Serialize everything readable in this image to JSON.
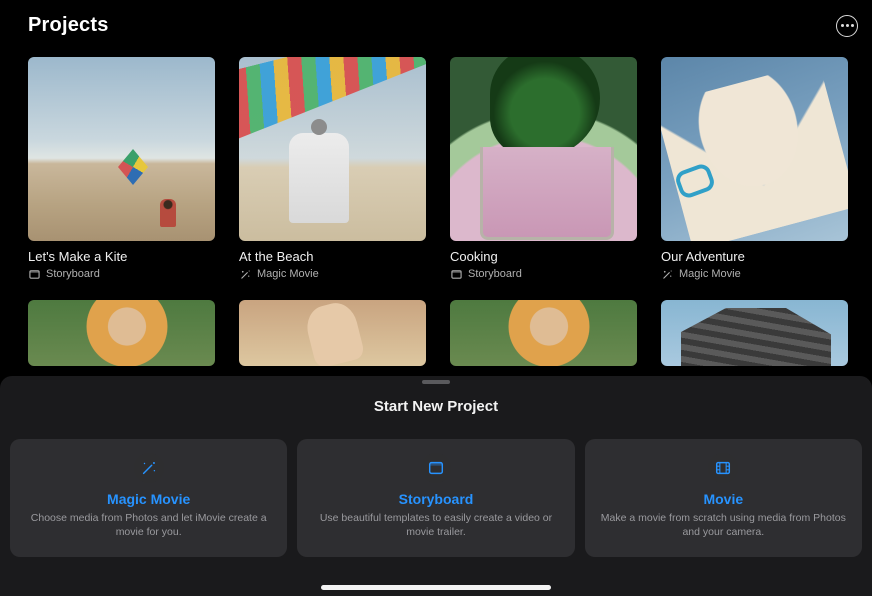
{
  "header": {
    "title": "Projects"
  },
  "projects": [
    {
      "title": "Let's Make a Kite",
      "kind": "Storyboard",
      "kindIcon": "storyboard"
    },
    {
      "title": "At the Beach",
      "kind": "Magic Movie",
      "kindIcon": "magic"
    },
    {
      "title": "Cooking",
      "kind": "Storyboard",
      "kindIcon": "storyboard"
    },
    {
      "title": "Our Adventure",
      "kind": "Magic Movie",
      "kindIcon": "magic"
    }
  ],
  "sheet": {
    "title": "Start New Project",
    "options": [
      {
        "title": "Magic Movie",
        "desc": "Choose media from Photos and let iMovie create a movie for you.",
        "icon": "wand"
      },
      {
        "title": "Storyboard",
        "desc": "Use beautiful templates to easily create a video or movie trailer.",
        "icon": "storyboard"
      },
      {
        "title": "Movie",
        "desc": "Make a movie from scratch using media from Photos and your camera.",
        "icon": "film"
      }
    ]
  }
}
